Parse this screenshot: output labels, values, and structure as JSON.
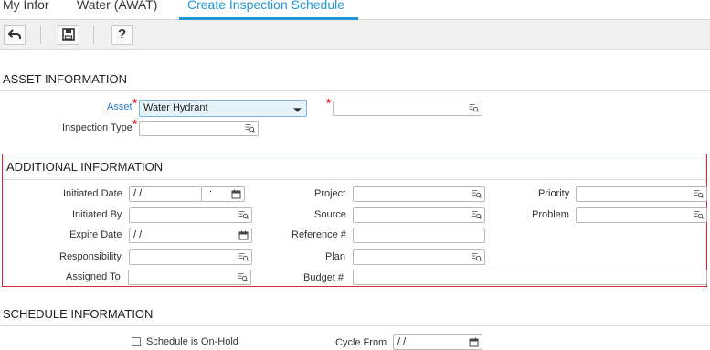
{
  "tabs": [
    {
      "label": "My Infor"
    },
    {
      "label": "Water (AWAT)"
    },
    {
      "label": "Create Inspection Schedule"
    }
  ],
  "toolbar": {
    "undo_icon": "undo-icon",
    "save_icon": "save-icon",
    "help_label": "?"
  },
  "asset_info": {
    "title": "ASSET INFORMATION",
    "asset_label": "Asset",
    "asset_value": "Water Hydrant",
    "inspection_type_label": "Inspection Type",
    "required_mark": "*"
  },
  "additional_info": {
    "title": "ADDITIONAL INFORMATION",
    "initiated_date_label": "Initiated Date",
    "initiated_date_value": "/ /",
    "initiated_time_value": ":",
    "initiated_by_label": "Initiated By",
    "expire_date_label": "Expire Date",
    "expire_date_value": "/ /",
    "responsibility_label": "Responsibility",
    "assigned_to_label": "Assigned To",
    "project_label": "Project",
    "source_label": "Source",
    "reference_label": "Reference #",
    "plan_label": "Plan",
    "budget_label": "Budget #",
    "priority_label": "Priority",
    "problem_label": "Problem"
  },
  "schedule_info": {
    "title": "SCHEDULE INFORMATION",
    "on_hold_label": "Schedule is On-Hold",
    "cycle_from_label": "Cycle From",
    "cycle_from_value": "/ /"
  },
  "colors": {
    "accent": "#2196d3",
    "required": "#d9252a",
    "link": "#2a7bc6"
  }
}
